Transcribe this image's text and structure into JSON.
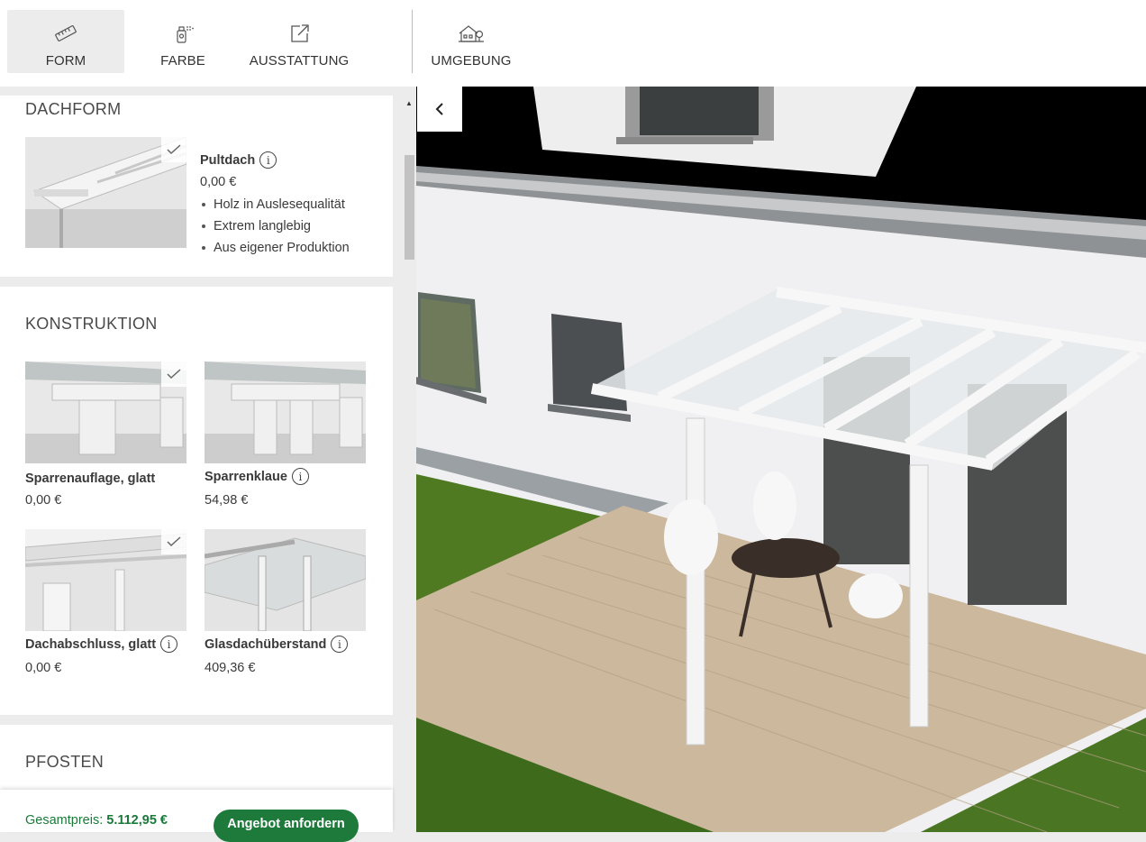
{
  "tabs": [
    {
      "label": "FORM",
      "icon": "ruler-icon",
      "active": true
    },
    {
      "label": "FARBE",
      "icon": "spray-can-icon",
      "active": false
    },
    {
      "label": "AUSSTATTUNG",
      "icon": "external-edit-icon",
      "active": false
    },
    {
      "label": "UMGEBUNG",
      "icon": "house-tree-icon",
      "active": false
    }
  ],
  "dachform": {
    "title": "DACHFORM",
    "option": {
      "name": "Pultdach",
      "price": "0,00 €",
      "selected": true,
      "features": [
        "Holz in Auslesequalität",
        "Extrem langlebig",
        "Aus eigener Produktion"
      ]
    }
  },
  "konstruktion": {
    "title": "KONSTRUKTION",
    "options": [
      {
        "name": "Sparrenauflage, glatt",
        "price": "0,00 €",
        "selected": true,
        "info": false
      },
      {
        "name": "Sparrenklaue",
        "price": "54,98 €",
        "selected": false,
        "info": true
      },
      {
        "name": "Dachabschluss, glatt",
        "price": "0,00 €",
        "selected": true,
        "info": true
      },
      {
        "name": "Glasdachüberstand",
        "price": "409,36 €",
        "selected": false,
        "info": true
      }
    ]
  },
  "pfosten": {
    "title": "PFOSTEN"
  },
  "footer": {
    "total_label": "Gesamtpreis:",
    "total_value": "5.112,95 €",
    "cta_label": "Angebot anfordern"
  },
  "colors": {
    "accent": "#1d7a3b",
    "active_tab_bg": "#ececec"
  }
}
